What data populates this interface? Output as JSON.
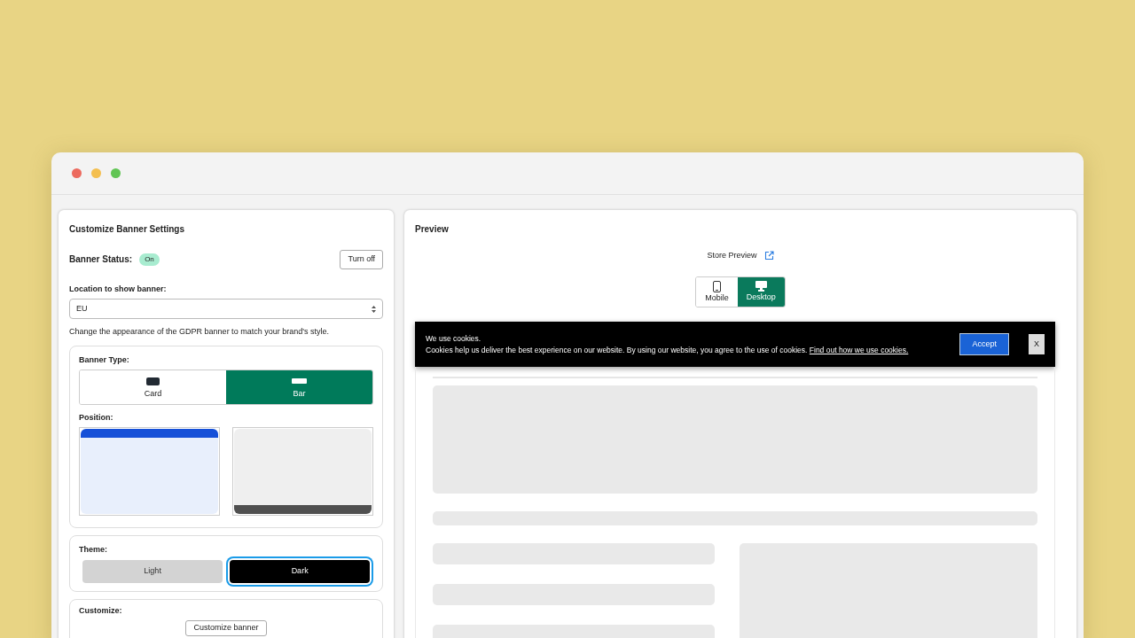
{
  "window": {
    "controls": [
      {
        "color": "#ec6a5e"
      },
      {
        "color": "#f4bf4f"
      },
      {
        "color": "#61c554"
      }
    ]
  },
  "settings": {
    "title": "Customize Banner Settings",
    "status_label": "Banner Status:",
    "status_badge": "On",
    "status_on": true,
    "toggle_button": "Turn off",
    "location_label": "Location to show banner:",
    "location_value": "EU",
    "description": "Change the appearance of the GDPR banner to match your brand's style.",
    "banner_type": {
      "label": "Banner Type:",
      "options": [
        {
          "label": "Card",
          "kind": "card",
          "selected": false
        },
        {
          "label": "Bar",
          "kind": "bar",
          "selected": true
        }
      ]
    },
    "position": {
      "label": "Position:",
      "options": [
        {
          "kind": "top",
          "selected": true
        },
        {
          "kind": "bottom",
          "selected": false
        }
      ]
    },
    "theme": {
      "label": "Theme:",
      "options": [
        {
          "label": "Light",
          "kind": "light",
          "selected": false
        },
        {
          "label": "Dark",
          "kind": "dark",
          "selected": true
        }
      ]
    },
    "customize": {
      "label": "Customize:",
      "button": "Customize banner"
    }
  },
  "preview": {
    "title": "Preview",
    "store_link": "Store Preview",
    "devices": [
      {
        "label": "Mobile",
        "kind": "mobile",
        "selected": false
      },
      {
        "label": "Desktop",
        "kind": "desktop",
        "selected": true
      }
    ],
    "banner": {
      "heading": "We use cookies.",
      "text": "Cookies help us deliver the best experience on our website. By using our website, you agree to the use of cookies.",
      "link": "Find out how we use cookies.",
      "accept": "Accept",
      "close": "X"
    }
  }
}
